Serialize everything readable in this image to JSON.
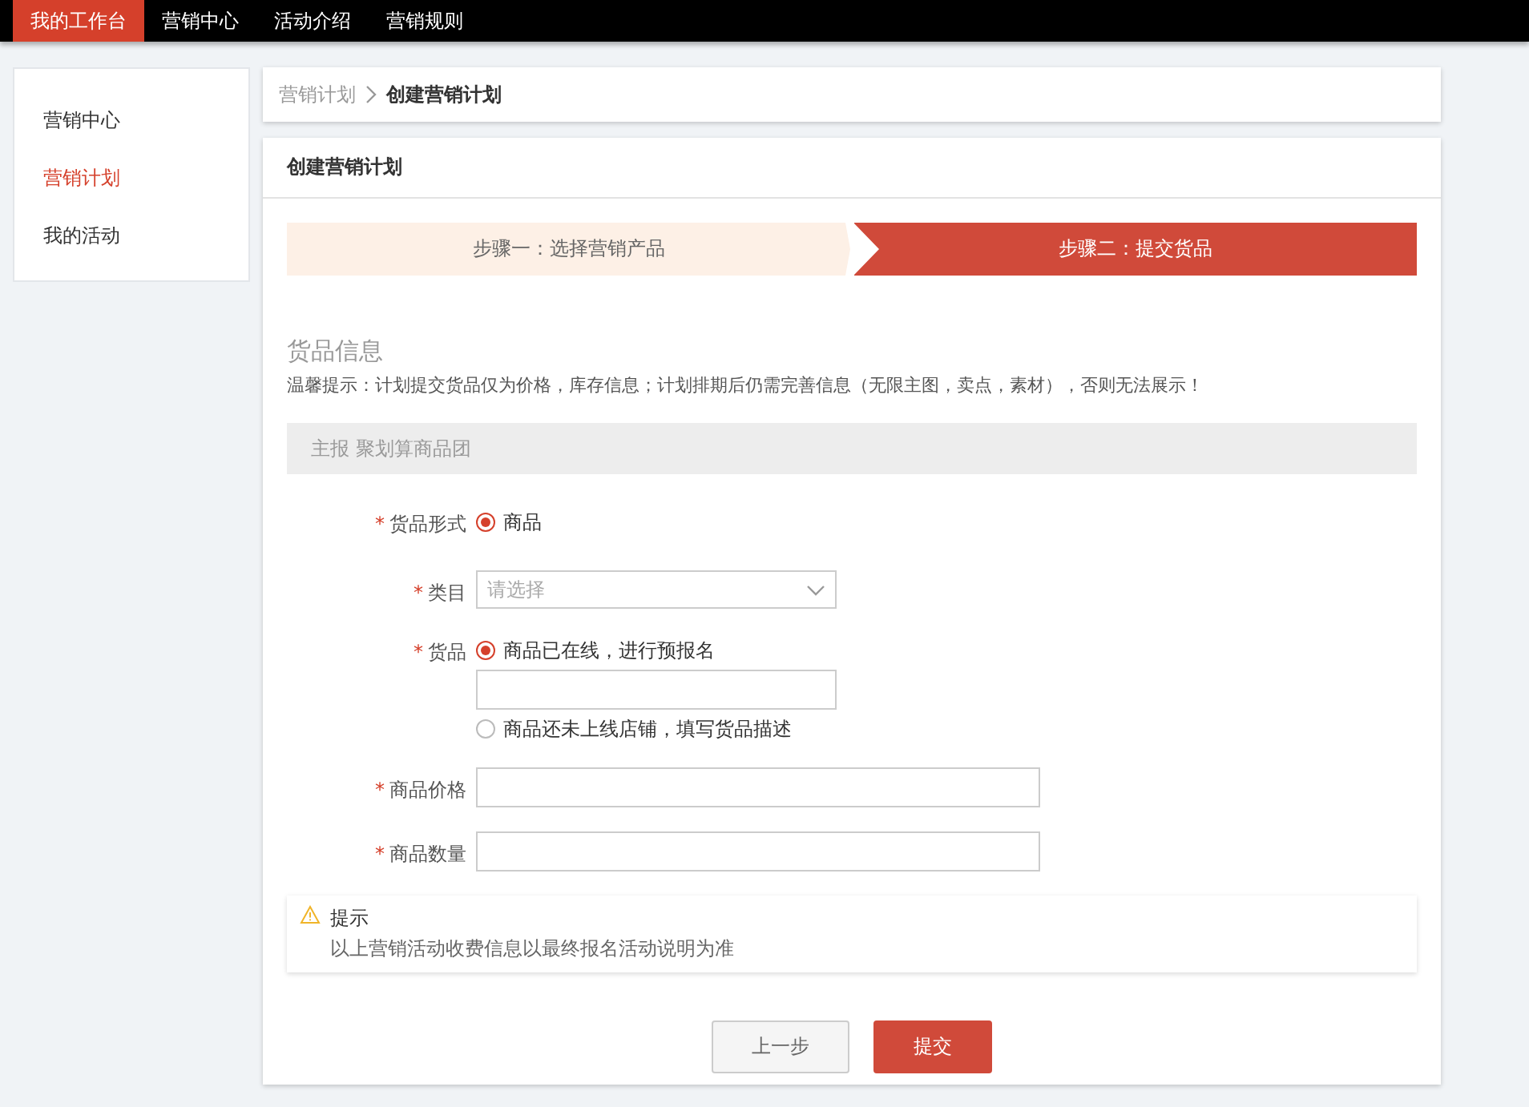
{
  "top_nav": [
    {
      "label": "我的工作台",
      "selected": true
    },
    {
      "label": "营销中心",
      "selected": false
    },
    {
      "label": "活动介绍",
      "selected": false
    },
    {
      "label": "营销规则",
      "selected": false
    }
  ],
  "sidebar": {
    "items": [
      {
        "label": "营销中心",
        "selected": false
      },
      {
        "label": "营销计划",
        "selected": true
      },
      {
        "label": "我的活动",
        "selected": false
      }
    ]
  },
  "breadcrumb": [
    {
      "label": "营销计划",
      "current": false
    },
    {
      "label": "创建营销计划",
      "current": true
    }
  ],
  "card_title": "创建营销计划",
  "steps": [
    {
      "label": "步骤一：选择营销产品",
      "selected": false
    },
    {
      "label": "步骤二：提交货品",
      "selected": true
    }
  ],
  "section": {
    "title": "货品信息",
    "notice": "温馨提示：计划提交货品仅为价格，库存信息；计划排期后仍需完善信息（无限主图，卖点，素材），否则无法展示！",
    "group_header": "主报 聚划算商品团"
  },
  "fields": [
    {
      "mark": "*",
      "label": "货品形式",
      "kind": "radio",
      "options": [
        {
          "kind": "radio",
          "label": "商品",
          "selected": true
        }
      ]
    },
    {
      "mark": "*",
      "label": "类目",
      "kind": "select",
      "placeholder": "请选择"
    },
    {
      "mark": "*",
      "label": "货品",
      "kind": "radio",
      "options": [
        {
          "kind": "radio",
          "label": "商品已在线，进行预报名",
          "selected": true
        },
        {
          "kind": "input"
        },
        {
          "kind": "radio",
          "label": "商品还未上线店铺，填写货品描述",
          "selected": false
        }
      ]
    },
    {
      "mark": "*",
      "label": "商品价格",
      "kind": "input"
    },
    {
      "mark": "*",
      "label": "商品数量",
      "kind": "input"
    }
  ],
  "tip": {
    "title": "提示",
    "text": "以上营销活动收费信息以最终报名活动说明为准"
  },
  "buttons": [
    {
      "label": "上一步",
      "kind": "secondary"
    },
    {
      "label": "提交",
      "kind": "primary"
    }
  ]
}
